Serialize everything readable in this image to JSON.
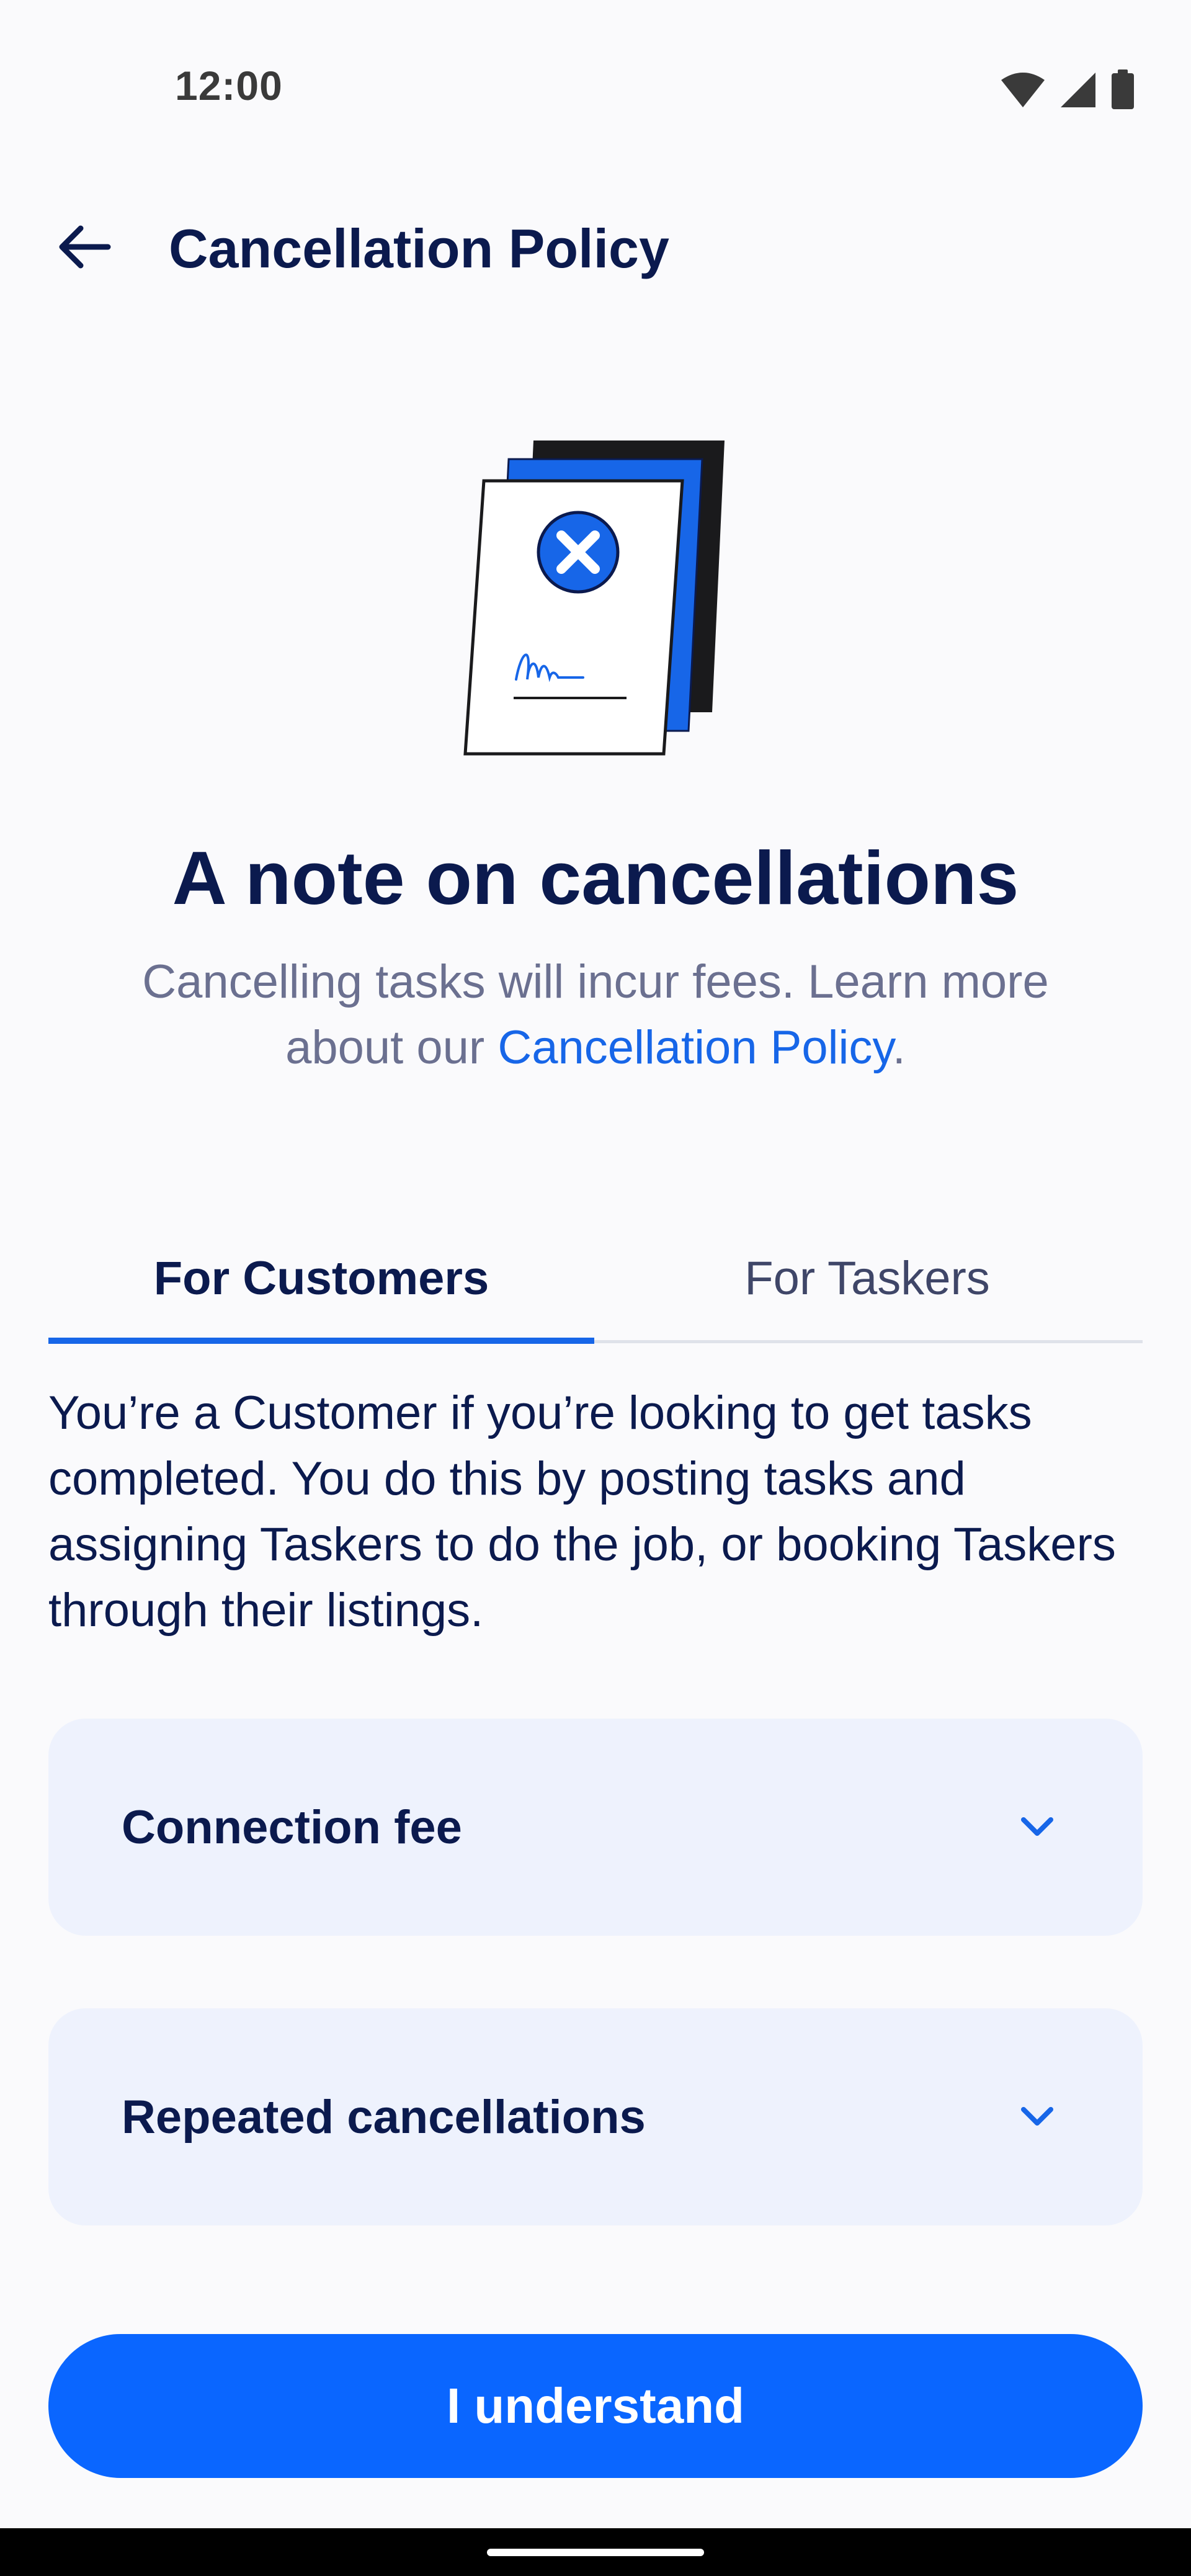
{
  "status_bar": {
    "time": "12:00",
    "icons": [
      "wifi-icon",
      "signal-icon",
      "battery-icon"
    ]
  },
  "header": {
    "back_icon": "arrow-left-icon",
    "title": "Cancellation Policy"
  },
  "illustration": {
    "icon": "cancelled-document-icon"
  },
  "intro": {
    "headline": "A note on cancellations",
    "subtext_prefix": "Cancelling tasks will incur fees. Learn more about our ",
    "subtext_link": "Cancellation Policy",
    "subtext_suffix": "."
  },
  "tabs": [
    {
      "label": "For Customers",
      "selected": true
    },
    {
      "label": "For Taskers",
      "selected": false
    }
  ],
  "description": "You’re a Customer if you’re looking to get tasks completed. You do this by posting tasks and assigning Taskers to do the job, or booking Taskers through their listings.",
  "accordions": [
    {
      "label": "Connection fee",
      "icon": "chevron-down-icon",
      "expanded": false
    },
    {
      "label": "Repeated cancellations",
      "icon": "chevron-down-icon",
      "expanded": false
    }
  ],
  "primary_button": {
    "label": "I understand"
  },
  "colors": {
    "accent": "#0a66ff",
    "link": "#1766e8",
    "text_primary": "#0b1a4e",
    "text_secondary": "#6b7090",
    "card_bg": "#eef2fd",
    "background": "#fafafc"
  }
}
